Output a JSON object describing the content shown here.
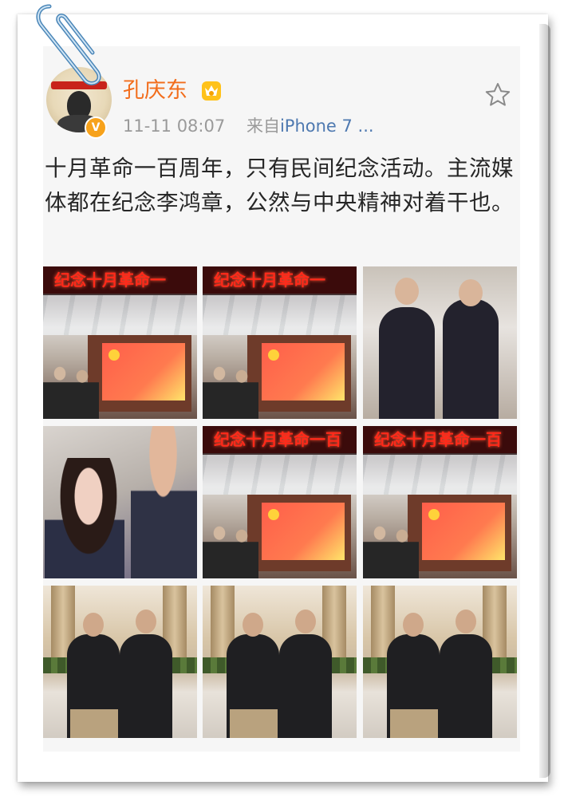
{
  "post": {
    "username": "孔庆东",
    "timestamp": "11-11 08:07",
    "source_prefix": "来自",
    "source_device": "iPhone 7 ...",
    "verified_glyph": "V",
    "text": "十月革命一百周年，只有民间纪念活动。主流媒体都在纪念李鸿章，公然与中央精神对着干也。",
    "photos": [
      {
        "kind": "banner-hall",
        "led_text": "纪念十月革命一"
      },
      {
        "kind": "banner-hall",
        "led_text": "纪念十月革命一"
      },
      {
        "kind": "couple"
      },
      {
        "kind": "selfie"
      },
      {
        "kind": "banner-hall",
        "led_text": "纪念十月革命一百"
      },
      {
        "kind": "banner-hall",
        "led_text": "纪念十月革命一百"
      },
      {
        "kind": "lobby"
      },
      {
        "kind": "lobby"
      },
      {
        "kind": "lobby"
      }
    ]
  },
  "icons": {
    "vip": "crown-vip-icon",
    "favorite": "star-icon",
    "clip": "paperclip-icon"
  },
  "colors": {
    "username": "#f26d1c",
    "source_link": "#4e79b0",
    "meta": "#9a9a9a",
    "verified": "#f7a21b"
  }
}
